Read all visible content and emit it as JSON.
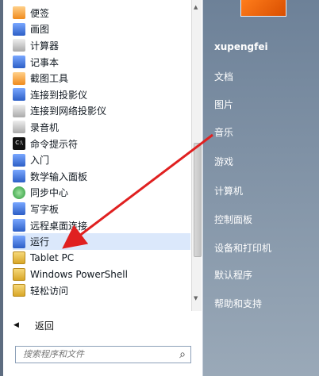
{
  "items": [
    {
      "label": "便签",
      "icon": "sticky-notes-icon"
    },
    {
      "label": "画图",
      "icon": "paint-icon"
    },
    {
      "label": "计算器",
      "icon": "calculator-icon"
    },
    {
      "label": "记事本",
      "icon": "notepad-icon"
    },
    {
      "label": "截图工具",
      "icon": "snipping-tool-icon"
    },
    {
      "label": "连接到投影仪",
      "icon": "projector-icon"
    },
    {
      "label": "连接到网络投影仪",
      "icon": "network-projector-icon"
    },
    {
      "label": "录音机",
      "icon": "sound-recorder-icon"
    },
    {
      "label": "命令提示符",
      "icon": "command-prompt-icon"
    },
    {
      "label": "入门",
      "icon": "getting-started-icon"
    },
    {
      "label": "数学输入面板",
      "icon": "math-input-icon"
    },
    {
      "label": "同步中心",
      "icon": "sync-center-icon"
    },
    {
      "label": "写字板",
      "icon": "wordpad-icon"
    },
    {
      "label": "远程桌面连接",
      "icon": "remote-desktop-icon"
    },
    {
      "label": "运行",
      "icon": "run-icon"
    },
    {
      "label": "Tablet PC",
      "icon": "folder-icon"
    },
    {
      "label": "Windows PowerShell",
      "icon": "folder-icon"
    },
    {
      "label": "轻松访问",
      "icon": "folder-icon"
    }
  ],
  "back_label": "返回",
  "search": {
    "placeholder": "搜索程序和文件"
  },
  "right": {
    "user": "xupengfei",
    "items": [
      "文档",
      "图片",
      "音乐",
      "游戏",
      "计算机",
      "控制面板",
      "设备和打印机",
      "默认程序",
      "帮助和支持"
    ]
  },
  "colors": {
    "annotation_arrow": "#e02020"
  }
}
